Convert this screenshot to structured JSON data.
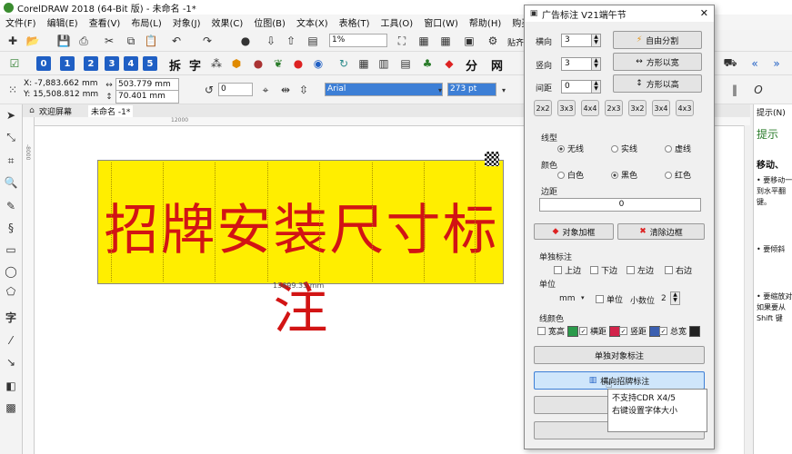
{
  "app": {
    "title": "CorelDRAW 2018 (64-Bit 版) - 未命名 -1*"
  },
  "menu": [
    "文件(F)",
    "编辑(E)",
    "查看(V)",
    "布局(L)",
    "对象(J)",
    "效果(C)",
    "位图(B)",
    "文本(X)",
    "表格(T)",
    "工具(O)",
    "窗口(W)",
    "帮助(H)",
    "购买"
  ],
  "toolbar": {
    "zoom": "1%",
    "paste_label": "贴齐"
  },
  "number_buttons": [
    "0",
    "1",
    "2",
    "3",
    "4",
    "5"
  ],
  "char_buttons": [
    "拆",
    "字",
    "分",
    "网"
  ],
  "props": {
    "x": "X: -7,883.662 mm",
    "y": "Y: 15,508.812 mm",
    "w": "503.779 mm",
    "h": "70.401 mm",
    "angle": "0",
    "font": "Arial",
    "font_size": "273 pt"
  },
  "tabs": {
    "welcome": "欢迎屏幕",
    "doc": "未命名 -1*"
  },
  "ruler": {
    "mark1": "12000",
    "mark2": "-8000"
  },
  "sign": {
    "text": "招牌安装尺寸标注",
    "width_label": "13699.33 mm",
    "color": "#ffee00",
    "text_color": "#d21414"
  },
  "dock": {
    "tab": "提示(N)",
    "heading": "提示",
    "sub": "移动、",
    "lines": [
      "• 要移动一",
      "到水平翻",
      "键。",
      "• 要倾斜",
      "• 要缩放对",
      "如果要从",
      "Shift 键"
    ]
  },
  "dialog": {
    "title": "广告标注 V21端午节",
    "h_label": "横向",
    "h_value": "3",
    "v_label": "竖向",
    "v_value": "3",
    "gap_label": "间距",
    "gap_value": "0",
    "btn_free": "自由分割",
    "btn_h": "方形以宽",
    "btn_v": "方形以高",
    "grids": [
      "2x2",
      "3x3",
      "4x4",
      "2x3",
      "3x2",
      "3x4",
      "4x3"
    ],
    "line_type_label": "线型",
    "line_types": [
      "无线",
      "实线",
      "虚线"
    ],
    "color_label": "颜色",
    "colors": [
      "白色",
      "黑色",
      "红色"
    ],
    "margin_label": "边距",
    "margin_value": "0",
    "btn_add": "对象加框",
    "btn_clear": "清除边框",
    "single_label": "单独标注",
    "sides": [
      "上边",
      "下边",
      "左边",
      "右边"
    ],
    "unit_label": "单位",
    "unit_value": "mm",
    "unit_chk": "单位",
    "decimals_label": "小数位",
    "decimals_value": "2",
    "linecolor_label": "线颜色",
    "lc_items": [
      "宽高",
      "横距",
      "竖距",
      "总宽"
    ],
    "btn_single": "单独对象标注",
    "btn_sign": "横向招牌标注",
    "btn_3": "…",
    "btn_4": "…"
  },
  "tooltip": {
    "line1": "不支持CDR X4/5",
    "line2": "右键设置字体大小"
  }
}
